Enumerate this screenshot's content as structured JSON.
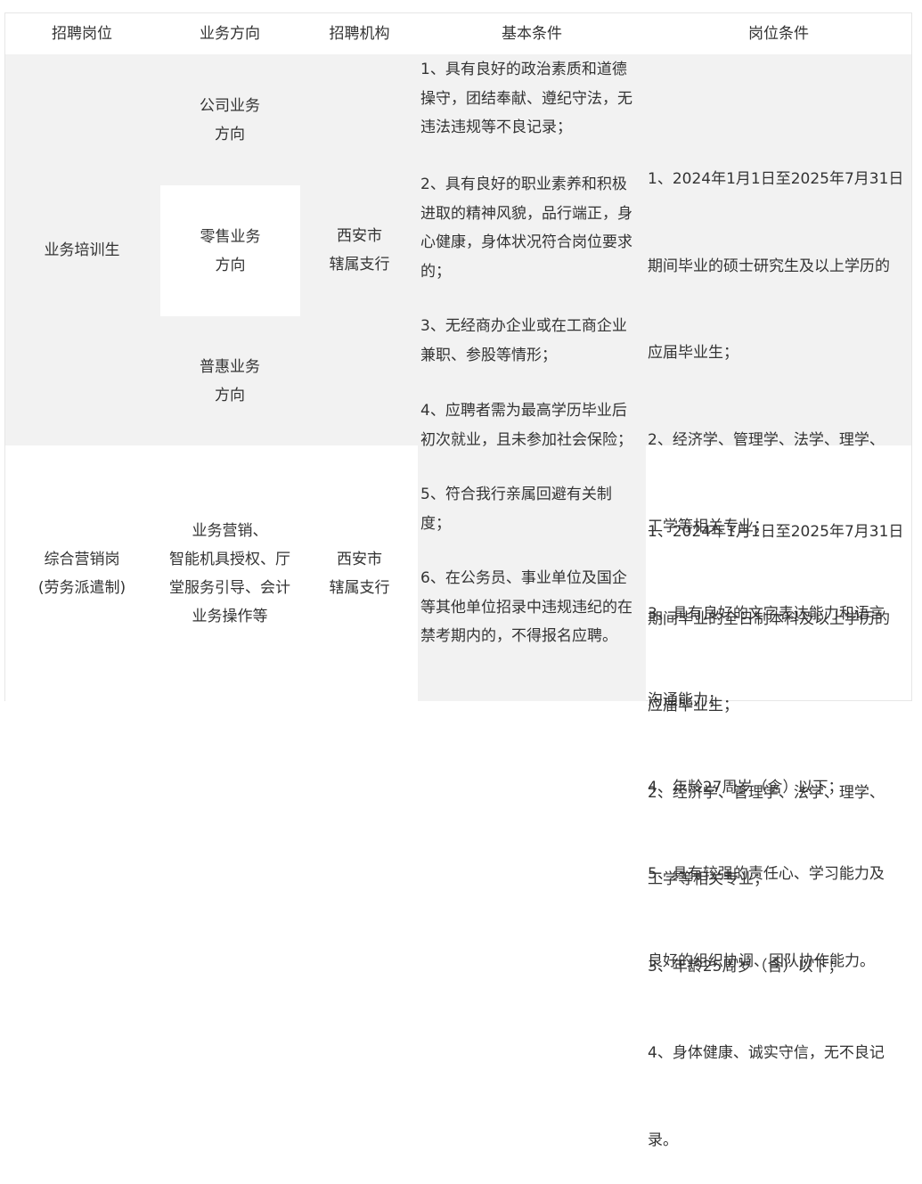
{
  "table": {
    "headers": [
      "招聘岗位",
      "业务方向",
      "招聘机构",
      "基本条件",
      "岗位条件"
    ],
    "rows": [
      {
        "position": "业务培训生",
        "directions": [
          [
            "公司业务",
            "方向"
          ],
          [
            "零售业务",
            "方向"
          ],
          [
            "普惠业务",
            "方向"
          ]
        ],
        "org": [
          "西安市",
          "辖属支行"
        ],
        "conditions": [
          "1、2024年1月1日至2025年7月31日",
          "期间毕业的硕士研究生及以上学历的",
          "应届毕业生；",
          "2、经济学、管理学、法学、理学、",
          "工学等相关专业；",
          "3、具有良好的文字表达能力和语言",
          "沟通能力；",
          "4、年龄27周岁（含）以下；",
          "5、具有较强的责任心、学习能力及",
          "良好的组织协调、团队协作能力。"
        ]
      },
      {
        "position": [
          "综合营销岗",
          "(劳务派遣制)"
        ],
        "direction": [
          "业务营销、",
          "智能机具授权、厅",
          "堂服务引导、会计",
          "业务操作等"
        ],
        "org": [
          "西安市",
          "辖属支行"
        ],
        "conditions": [
          "1、2024年1月1日至2025年7月31日",
          "期间毕业的全日制本科及以上学历的",
          "应届毕业生；",
          "2、经济学、管理学、法学、理学、",
          "工学等相关专业；",
          "3、年龄25周岁（含）以下；",
          "4、身体健康、诚实守信，无不良记",
          "录。"
        ]
      }
    ],
    "basic_conditions": [
      [
        "1、具有良好的政治素质和道德",
        "操守，团结奉献、遵纪守法，无",
        "违法违规等不良记录；"
      ],
      [
        "2、具有良好的职业素养和积极",
        "进取的精神风貌，品行端正，身",
        "心健康，身体状况符合岗位要求",
        "的；"
      ],
      [
        "3、无经商办企业或在工商企业",
        "兼职、参股等情形；"
      ],
      [
        "4、应聘者需为最高学历毕业后",
        "初次就业，且未参加社会保险；"
      ],
      [
        "5、符合我行亲属回避有关制",
        "度；"
      ],
      [
        "6、在公务员、事业单位及国企",
        "等其他单位招录中违规违纪的在",
        "禁考期内的，不得报名应聘。"
      ]
    ]
  }
}
